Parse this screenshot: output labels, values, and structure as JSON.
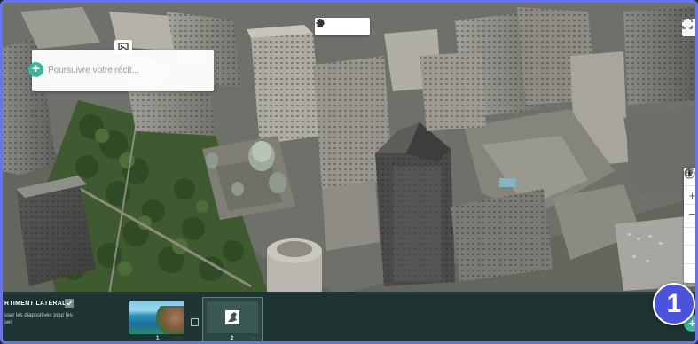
{
  "story": {
    "placeholder": "Poursuivre votre récit..."
  },
  "toolbar": {
    "edit_icon": "pencil-icon",
    "settings_icon": "gear-icon",
    "delete_icon": "trash-icon"
  },
  "map_controls": [
    "home-icon",
    "zoom-in-icon",
    "zoom-out-icon",
    "pan-icon",
    "rotate-icon",
    "compass-icon"
  ],
  "filmstrip": {
    "side_panel_label": "RTIMENT LATÉRAL",
    "side_panel_desc": "sser les diapositives pour les\nser",
    "slides": [
      {
        "number": "1",
        "more": "···"
      },
      {
        "number": "2",
        "more": "···"
      }
    ]
  },
  "badge": {
    "step": "1"
  },
  "colors": {
    "frame": "#6b74e6",
    "accent": "#3fb59d",
    "filmstrip_bg": "#1e3432",
    "badge": "#4a53d9"
  }
}
